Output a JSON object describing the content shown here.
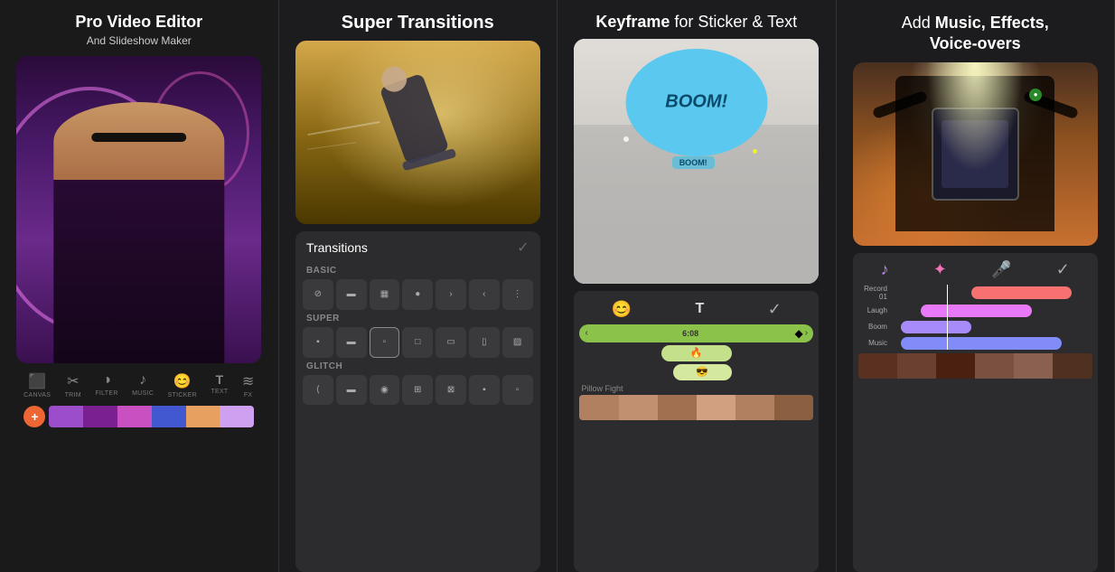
{
  "panels": [
    {
      "id": "panel-1",
      "header": {
        "line1": "Pro Video Editor",
        "line2": "And Slideshow Maker"
      },
      "toolbar": {
        "icons": [
          {
            "symbol": "⬜",
            "label": "CANVAS"
          },
          {
            "symbol": "✂️",
            "label": "TRIM"
          },
          {
            "symbol": "☁️",
            "label": "FILTER"
          },
          {
            "symbol": "🎵",
            "label": "MUSIC"
          },
          {
            "symbol": "😊",
            "label": "STICKER"
          },
          {
            "symbol": "T",
            "label": "TEXT"
          },
          {
            "symbol": "✏️",
            "label": "FX"
          }
        ]
      },
      "plus_button": "+",
      "timeline_colors": [
        "#9b4dca",
        "#e63",
        "#c850c0",
        "#4158d0",
        "#e8a"
      ]
    },
    {
      "id": "panel-2",
      "header": "Super Transitions",
      "transitions_label": "Transitions",
      "sections": [
        "BASIC",
        "SUPER",
        "GLITCH"
      ],
      "check": "✓"
    },
    {
      "id": "panel-3",
      "header_normal": " for Sticker & Text",
      "header_bold": "Keyframe",
      "track_label": "Pillow Fight",
      "track_emoji": "🔥",
      "track_emoji2": "😎",
      "check": "✓"
    },
    {
      "id": "panel-4",
      "header_line1": "Add ",
      "header_bold1": "Music, Effects,",
      "header_line2": "",
      "header_bold2": "Voice-overs",
      "tracks": [
        {
          "name": "Record 01",
          "class": "track-record",
          "width": "55%",
          "offset": "40%"
        },
        {
          "name": "Laugh",
          "class": "track-laugh",
          "width": "45%",
          "offset": "30%"
        },
        {
          "name": "Boom",
          "class": "track-boom",
          "width": "35%",
          "offset": "5%"
        },
        {
          "name": "Music",
          "class": "track-music",
          "width": "80%",
          "offset": "5%"
        }
      ],
      "check": "✓"
    }
  ],
  "icons": {
    "music_note": "♪",
    "sparkle": "✦",
    "mic": "🎤",
    "smiley": "😊",
    "text_t": "T",
    "check": "✓",
    "arrow_left": "‹",
    "arrow_right": "›",
    "no_symbol": "⊘",
    "plus": "+"
  },
  "colors": {
    "bg_dark": "#1a1a1a",
    "bg_panel": "#1c1c1e",
    "accent_red": "#e63322",
    "accent_green": "#8bc34a",
    "accent_blue": "#5bc8ef",
    "accent_purple": "#c084fc",
    "accent_pink": "#f472b6",
    "text_white": "#ffffff",
    "text_gray": "#888888"
  }
}
